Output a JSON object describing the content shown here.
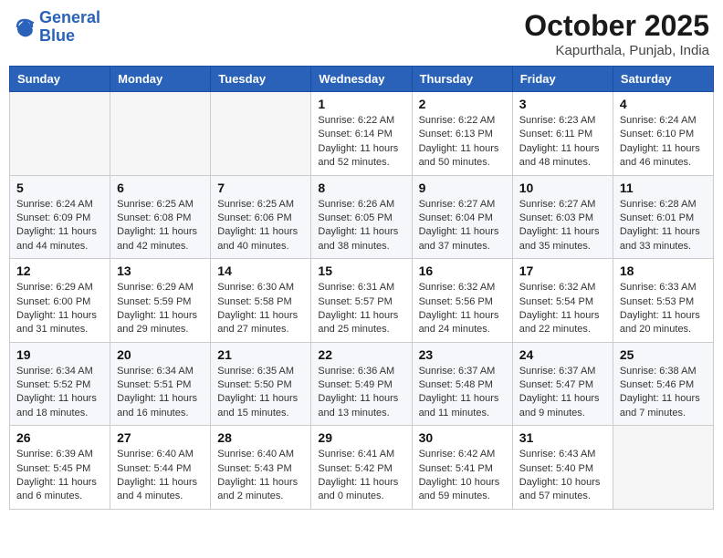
{
  "header": {
    "logo_line1": "General",
    "logo_line2": "Blue",
    "month": "October 2025",
    "location": "Kapurthala, Punjab, India"
  },
  "days_of_week": [
    "Sunday",
    "Monday",
    "Tuesday",
    "Wednesday",
    "Thursday",
    "Friday",
    "Saturday"
  ],
  "weeks": [
    [
      {
        "day": "",
        "info": ""
      },
      {
        "day": "",
        "info": ""
      },
      {
        "day": "",
        "info": ""
      },
      {
        "day": "1",
        "info": "Sunrise: 6:22 AM\nSunset: 6:14 PM\nDaylight: 11 hours\nand 52 minutes."
      },
      {
        "day": "2",
        "info": "Sunrise: 6:22 AM\nSunset: 6:13 PM\nDaylight: 11 hours\nand 50 minutes."
      },
      {
        "day": "3",
        "info": "Sunrise: 6:23 AM\nSunset: 6:11 PM\nDaylight: 11 hours\nand 48 minutes."
      },
      {
        "day": "4",
        "info": "Sunrise: 6:24 AM\nSunset: 6:10 PM\nDaylight: 11 hours\nand 46 minutes."
      }
    ],
    [
      {
        "day": "5",
        "info": "Sunrise: 6:24 AM\nSunset: 6:09 PM\nDaylight: 11 hours\nand 44 minutes."
      },
      {
        "day": "6",
        "info": "Sunrise: 6:25 AM\nSunset: 6:08 PM\nDaylight: 11 hours\nand 42 minutes."
      },
      {
        "day": "7",
        "info": "Sunrise: 6:25 AM\nSunset: 6:06 PM\nDaylight: 11 hours\nand 40 minutes."
      },
      {
        "day": "8",
        "info": "Sunrise: 6:26 AM\nSunset: 6:05 PM\nDaylight: 11 hours\nand 38 minutes."
      },
      {
        "day": "9",
        "info": "Sunrise: 6:27 AM\nSunset: 6:04 PM\nDaylight: 11 hours\nand 37 minutes."
      },
      {
        "day": "10",
        "info": "Sunrise: 6:27 AM\nSunset: 6:03 PM\nDaylight: 11 hours\nand 35 minutes."
      },
      {
        "day": "11",
        "info": "Sunrise: 6:28 AM\nSunset: 6:01 PM\nDaylight: 11 hours\nand 33 minutes."
      }
    ],
    [
      {
        "day": "12",
        "info": "Sunrise: 6:29 AM\nSunset: 6:00 PM\nDaylight: 11 hours\nand 31 minutes."
      },
      {
        "day": "13",
        "info": "Sunrise: 6:29 AM\nSunset: 5:59 PM\nDaylight: 11 hours\nand 29 minutes."
      },
      {
        "day": "14",
        "info": "Sunrise: 6:30 AM\nSunset: 5:58 PM\nDaylight: 11 hours\nand 27 minutes."
      },
      {
        "day": "15",
        "info": "Sunrise: 6:31 AM\nSunset: 5:57 PM\nDaylight: 11 hours\nand 25 minutes."
      },
      {
        "day": "16",
        "info": "Sunrise: 6:32 AM\nSunset: 5:56 PM\nDaylight: 11 hours\nand 24 minutes."
      },
      {
        "day": "17",
        "info": "Sunrise: 6:32 AM\nSunset: 5:54 PM\nDaylight: 11 hours\nand 22 minutes."
      },
      {
        "day": "18",
        "info": "Sunrise: 6:33 AM\nSunset: 5:53 PM\nDaylight: 11 hours\nand 20 minutes."
      }
    ],
    [
      {
        "day": "19",
        "info": "Sunrise: 6:34 AM\nSunset: 5:52 PM\nDaylight: 11 hours\nand 18 minutes."
      },
      {
        "day": "20",
        "info": "Sunrise: 6:34 AM\nSunset: 5:51 PM\nDaylight: 11 hours\nand 16 minutes."
      },
      {
        "day": "21",
        "info": "Sunrise: 6:35 AM\nSunset: 5:50 PM\nDaylight: 11 hours\nand 15 minutes."
      },
      {
        "day": "22",
        "info": "Sunrise: 6:36 AM\nSunset: 5:49 PM\nDaylight: 11 hours\nand 13 minutes."
      },
      {
        "day": "23",
        "info": "Sunrise: 6:37 AM\nSunset: 5:48 PM\nDaylight: 11 hours\nand 11 minutes."
      },
      {
        "day": "24",
        "info": "Sunrise: 6:37 AM\nSunset: 5:47 PM\nDaylight: 11 hours\nand 9 minutes."
      },
      {
        "day": "25",
        "info": "Sunrise: 6:38 AM\nSunset: 5:46 PM\nDaylight: 11 hours\nand 7 minutes."
      }
    ],
    [
      {
        "day": "26",
        "info": "Sunrise: 6:39 AM\nSunset: 5:45 PM\nDaylight: 11 hours\nand 6 minutes."
      },
      {
        "day": "27",
        "info": "Sunrise: 6:40 AM\nSunset: 5:44 PM\nDaylight: 11 hours\nand 4 minutes."
      },
      {
        "day": "28",
        "info": "Sunrise: 6:40 AM\nSunset: 5:43 PM\nDaylight: 11 hours\nand 2 minutes."
      },
      {
        "day": "29",
        "info": "Sunrise: 6:41 AM\nSunset: 5:42 PM\nDaylight: 11 hours\nand 0 minutes."
      },
      {
        "day": "30",
        "info": "Sunrise: 6:42 AM\nSunset: 5:41 PM\nDaylight: 10 hours\nand 59 minutes."
      },
      {
        "day": "31",
        "info": "Sunrise: 6:43 AM\nSunset: 5:40 PM\nDaylight: 10 hours\nand 57 minutes."
      },
      {
        "day": "",
        "info": ""
      }
    ]
  ]
}
